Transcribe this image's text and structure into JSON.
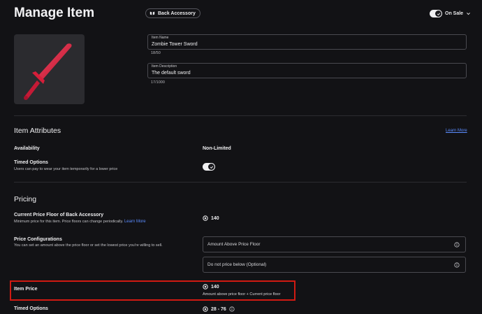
{
  "header": {
    "title": "Manage Item",
    "category": "Back Accessory",
    "sale_status": "On Sale"
  },
  "item": {
    "name_label": "Item Name",
    "name_value": "Zombie Tower Sword",
    "name_counter": "18/50",
    "description_label": "Item Description",
    "description_value": "The default sword",
    "description_counter": "17/1000"
  },
  "attributes": {
    "title": "Item Attributes",
    "learn_more": "Learn More",
    "availability_label": "Availability",
    "availability_value": "Non-Limited",
    "timed_label": "Timed Options",
    "timed_sub": "Users can pay to wear your item temporarily for a lower price"
  },
  "pricing": {
    "title": "Pricing",
    "floor_label": "Current Price Floor of Back Accessory",
    "floor_sub": "Minimum price for this item. Price floors can change periodically.",
    "floor_learn_more": "Learn More",
    "floor_value": "140",
    "config_label": "Price Configurations",
    "config_sub": "You can set an amount above the price floor or set the lowest price you're willing to sell.",
    "amount_above_placeholder": "Amount Above Price Floor",
    "do_not_price_below_placeholder": "Do not price below (Optional)",
    "item_price_label": "Item Price",
    "item_price_value": "140",
    "item_price_sub": "Amount above price floor + Current price floor",
    "timed_label": "Timed Options",
    "timed_value": "28 - 76"
  },
  "colors": {
    "background": "#121215",
    "accent_link": "#5b8cff",
    "highlight": "#d11a12",
    "sword": "#e0243f"
  }
}
